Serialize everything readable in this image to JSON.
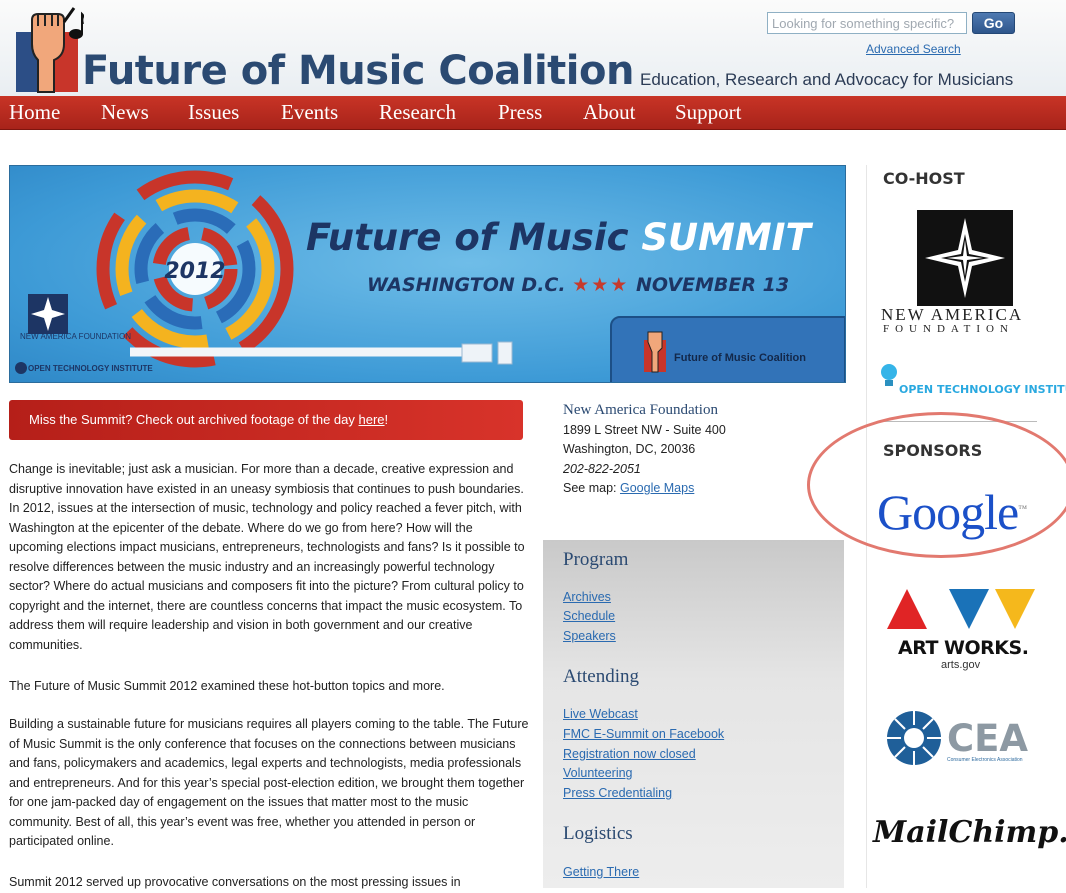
{
  "header": {
    "site_title": "Future of Music Coalition",
    "tagline": "Education, Research and Advocacy for Musicians",
    "search_placeholder": "Looking for something specific?",
    "go_label": "Go",
    "advanced_search": "Advanced Search"
  },
  "nav": [
    {
      "label": "Home"
    },
    {
      "label": "News"
    },
    {
      "label": "Issues"
    },
    {
      "label": "Events"
    },
    {
      "label": "Research"
    },
    {
      "label": "Press"
    },
    {
      "label": "About"
    },
    {
      "label": "Support"
    }
  ],
  "banner": {
    "year": "2012",
    "title_main": "Future of Music ",
    "title_accent": "SUMMIT",
    "location": "WASHINGTON D.C.",
    "stars": "★★★",
    "date": "NOVEMBER 13",
    "fmc_label": "Future of Music Coalition",
    "nam_label": "NEW AMERICA FOUNDATION",
    "oti_label": "OPEN TECHNOLOGY INSTITUTE"
  },
  "alert": {
    "text": "Miss the Summit? Check out archived footage of the day ",
    "link": "here",
    "suffix": "!"
  },
  "body": {
    "paragraph1": "Change is inevitable; just ask a musician. For more than a decade, creative expression and disruptive innovation have existed in an uneasy symbiosis that continues to push boundaries. In 2012, issues at the intersection of music, technology and policy reached a fever pitch, with Washington at the epicenter of the debate. Where do we go from here? How will the upcoming elections impact musicians, entrepreneurs, technologists and fans? Is it possible to resolve differences between the music industry and an increasingly powerful technology sector? Where do actual musicians and composers fit into the picture? From cultural policy to copyright and the internet, there are countless concerns that impact the music ecosystem. To address them will require leadership and vision in both government and our creative communities.",
    "paragraph2": "The Future of Music Summit 2012 examined these hot-button topics and more.",
    "paragraph3": "Building a sustainable future for musicians requires all players coming to the table. The Future of Music Summit is the only conference that focuses on the connections between musicians and fans, policymakers and academics, legal experts and technologists, media professionals and entrepreneurs. And for this year’s special post-election edition, we brought them together for one jam-packed day of engagement on the issues that matter most to the music community. Best of all, this year’s event was free, whether you attended in person or participated online.",
    "paragraph4": "Summit 2012 served up provocative conversations on the most pressing issues in"
  },
  "address": {
    "name": "New America Foundation",
    "street": "1899 L Street NW - Suite 400",
    "city": "Washington, DC, 20036",
    "phone": "202-822-2051",
    "map_prefix": "See map: ",
    "map_link": "Google Maps"
  },
  "program_box": {
    "program_heading": "Program",
    "program_links": [
      "Archives",
      "Schedule",
      "Speakers"
    ],
    "attending_heading": "Attending",
    "attending_links": [
      "Live Webcast",
      "FMC E-Summit on Facebook",
      "Registration now closed",
      "Volunteering",
      "Press Credentialing"
    ],
    "logistics_heading": "Logistics",
    "logistics_links": [
      "Getting There"
    ]
  },
  "sidebar": {
    "cohost_heading": "CO-HOST",
    "nam_name": "NEW AMERICA",
    "nam_sub": "FOUNDATION",
    "oti_name": "OPEN TECHNOLOGY INSTITUTE",
    "sponsors_heading": "SPONSORS",
    "google": "Google",
    "google_tm": "™",
    "artworks": "ART WORKS.",
    "artsgov": "arts.gov",
    "cea": "CEA",
    "cea_sub": "Consumer Electronics Association",
    "mailchimp": "MailChimp."
  },
  "colors": {
    "brand_blue": "#2b4a72",
    "nav_red": "#b8281d",
    "link_blue": "#2a6ab0",
    "highlight_circle": "#e2796f"
  }
}
